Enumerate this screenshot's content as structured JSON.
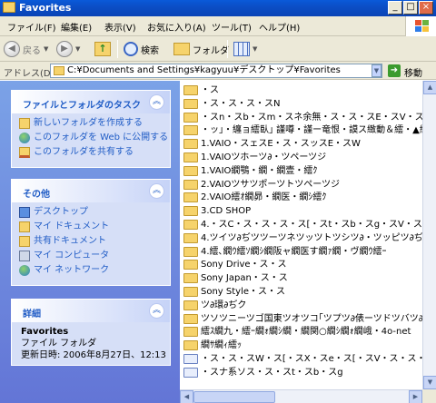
{
  "window": {
    "title": "Favorites",
    "buttons": {
      "minimize": "_",
      "maximize": "□",
      "close": "×"
    }
  },
  "menu": [
    "ファイル(F)",
    "編集(E)",
    "表示(V)",
    "お気に入り(A)",
    "ツール(T)",
    "ヘルプ(H)"
  ],
  "toolbar": {
    "back_label": "戻る",
    "search_label": "検索",
    "folders_label": "フォルダ"
  },
  "address": {
    "label": "アドレス(D)",
    "path": "C:¥Documents and Settings¥kagyuu¥デスクトップ¥Favorites",
    "go_label": "移動"
  },
  "tasks_panel": {
    "title": "ファイルとフォルダのタスク",
    "items": [
      "新しいフォルダを作成する",
      "このフォルダを Web に公開する",
      "このフォルダを共有する"
    ]
  },
  "other_panel": {
    "title": "その他",
    "items": [
      "デスクトップ",
      "マイ ドキュメント",
      "共有ドキュメント",
      "マイ コンピュータ",
      "マイ ネットワーク"
    ]
  },
  "details_panel": {
    "title": "詳細",
    "name": "Favorites",
    "type": "ファイル フォルダ",
    "modified": "更新日時: 2006年8月27日、12:13"
  },
  "files": [
    {
      "name": "・ス",
      "kind": "folder"
    },
    {
      "name": "・ス・ス・ス・スN",
      "kind": "folder"
    },
    {
      "name": "・スn・スb・スm・スネ余無・ス・ス・スE・スV・ス・スE・スy・ス・ス・ス・ス・ス",
      "kind": "folder"
    },
    {
      "name": "・ッ｣・纏ョ繧臥｣ 謹噂・謹ー竜恨・謨ス緻動＆繧・▲繧ｦ繧・ッ",
      "kind": "folder"
    },
    {
      "name": "1.VAIO・スェスE・ス・スッスE・スW",
      "kind": "folder"
    },
    {
      "name": "1.VAIOツホーツ∂・ツペーツジ",
      "kind": "folder"
    },
    {
      "name": "1.VAIO繝鶚・繝・繝壹・繧ｸ",
      "kind": "folder"
    },
    {
      "name": "2.VAIOツサツポーツトツペーツジ",
      "kind": "folder"
    },
    {
      "name": "2.VAIO繧ｵ繝昴・繝医・繝ｼ繧ｸ",
      "kind": "folder"
    },
    {
      "name": "3.CD SHOP",
      "kind": "folder"
    },
    {
      "name": "4.・スC・ス・ス・ス・ス[・スt・スb・スg・スV・ス・スス・スb・スs・ス・スO",
      "kind": "folder"
    },
    {
      "name": "4.ツイツ∂ぢツツーツネツッツトツシツ∂・ツッピツ∂ぢグ",
      "kind": "folder"
    },
    {
      "name": "4.繧､繝ｳ繧ｿ繝ｼ繝阪ャ繝医す繝ｧ繝・ヴ繝ｳ繧ｰ",
      "kind": "folder"
    },
    {
      "name": "Sony Drive・ス・ス",
      "kind": "folder"
    },
    {
      "name": "Sony Japan・ス・ス",
      "kind": "folder"
    },
    {
      "name": "Sony Style・ス・ス",
      "kind": "folder"
    },
    {
      "name": "ツ∂環∂ぢク",
      "kind": "folder"
    },
    {
      "name": "ツソツニーツゴ国東ツオツコ｢ツプツ∂俵ーツドツバツ∂ぢドツ｡So-net",
      "kind": "folder"
    },
    {
      "name": "繧ｽ繝九・繧ｰ繝ｫ繝ｼ繝・繝関○繝ｼ繝ｫ繝峨・4o-net",
      "kind": "folder"
    },
    {
      "name": "繝ｻ繝ｨ繧ｯ",
      "kind": "folder"
    },
    {
      "name": "・ス・ス・スW・ス[・スX・スe・ス[・スV・ス・ス・ス・スK・スC・スh",
      "kind": "shortcut"
    },
    {
      "name": "・スナ系ソス・ス・スt・スb・スg",
      "kind": "shortcut"
    }
  ],
  "colors": {
    "title_bar": "#0a5ad9",
    "task_link": "#215dc6",
    "left_pane": "#7ba2e7",
    "folder": "#f6d36b"
  }
}
